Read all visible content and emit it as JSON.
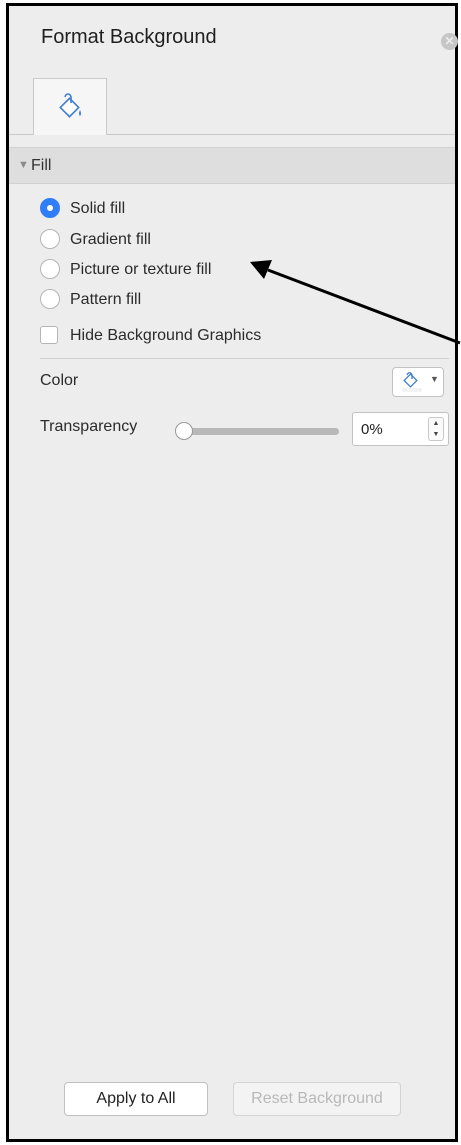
{
  "panel": {
    "title": "Format Background",
    "close_icon": "close-icon",
    "tab_icon": "paint-bucket-icon"
  },
  "fill_section": {
    "header": "Fill",
    "options": [
      {
        "label": "Solid fill",
        "selected": true
      },
      {
        "label": "Gradient fill",
        "selected": false
      },
      {
        "label": "Picture or texture fill",
        "selected": false
      },
      {
        "label": "Pattern fill",
        "selected": false
      }
    ],
    "hide_graphics": {
      "label": "Hide Background Graphics",
      "checked": false
    },
    "color": {
      "label": "Color",
      "button_icon": "paint-bucket-icon"
    },
    "transparency": {
      "label": "Transparency",
      "value": "0%",
      "level": 0
    }
  },
  "footer": {
    "apply_label": "Apply to All",
    "reset_label": "Reset Background"
  },
  "annotation": {
    "type": "arrow",
    "points_to": "Picture or texture fill"
  },
  "colors": {
    "panel_bg": "#ededed",
    "accent_blue": "#2f7ef7",
    "border": "#000000"
  }
}
